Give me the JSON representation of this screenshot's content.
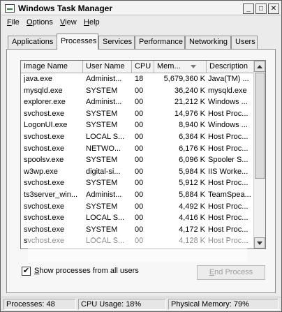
{
  "window": {
    "title": "Windows Task Manager"
  },
  "title_buttons": {
    "minimize": "_",
    "maximize": "□",
    "close": "✕"
  },
  "menu": [
    {
      "label": "File",
      "hotkey": "F",
      "rest": "ile"
    },
    {
      "label": "Options",
      "hotkey": "O",
      "rest": "ptions"
    },
    {
      "label": "View",
      "hotkey": "V",
      "rest": "iew"
    },
    {
      "label": "Help",
      "hotkey": "H",
      "rest": "elp"
    }
  ],
  "tabs": [
    {
      "label": "Applications",
      "active": false
    },
    {
      "label": "Processes",
      "active": true
    },
    {
      "label": "Services",
      "active": false
    },
    {
      "label": "Performance",
      "active": false
    },
    {
      "label": "Networking",
      "active": false
    },
    {
      "label": "Users",
      "active": false
    }
  ],
  "columns": [
    "Image Name",
    "User Name",
    "CPU",
    "Mem...",
    "Description"
  ],
  "processes": [
    {
      "name": "java.exe",
      "user": "Administ...",
      "cpu": "18",
      "mem": "5,679,360 K",
      "desc": "Java(TM) ..."
    },
    {
      "name": "mysqld.exe",
      "user": "SYSTEM",
      "cpu": "00",
      "mem": "36,240 K",
      "desc": "mysqld.exe"
    },
    {
      "name": "explorer.exe",
      "user": "Administ...",
      "cpu": "00",
      "mem": "21,212 K",
      "desc": "Windows ..."
    },
    {
      "name": "svchost.exe",
      "user": "SYSTEM",
      "cpu": "00",
      "mem": "14,976 K",
      "desc": "Host Proc..."
    },
    {
      "name": "LogonUI.exe",
      "user": "SYSTEM",
      "cpu": "00",
      "mem": "8,940 K",
      "desc": "Windows ..."
    },
    {
      "name": "svchost.exe",
      "user": "LOCAL S...",
      "cpu": "00",
      "mem": "6,364 K",
      "desc": "Host Proc..."
    },
    {
      "name": "svchost.exe",
      "user": "NETWO...",
      "cpu": "00",
      "mem": "6,176 K",
      "desc": "Host Proc..."
    },
    {
      "name": "spoolsv.exe",
      "user": "SYSTEM",
      "cpu": "00",
      "mem": "6,096 K",
      "desc": "Spooler S..."
    },
    {
      "name": "w3wp.exe",
      "user": "digital-si...",
      "cpu": "00",
      "mem": "5,984 K",
      "desc": "IIS Worke..."
    },
    {
      "name": "svchost.exe",
      "user": "SYSTEM",
      "cpu": "00",
      "mem": "5,912 K",
      "desc": "Host Proc..."
    },
    {
      "name": "ts3server_win...",
      "user": "Administ...",
      "cpu": "00",
      "mem": "5,884 K",
      "desc": "TeamSpea..."
    },
    {
      "name": "svchost.exe",
      "user": "SYSTEM",
      "cpu": "00",
      "mem": "4,492 K",
      "desc": "Host Proc..."
    },
    {
      "name": "svchost.exe",
      "user": "LOCAL S...",
      "cpu": "00",
      "mem": "4,416 K",
      "desc": "Host Proc..."
    },
    {
      "name": "svchost.exe",
      "user": "SYSTEM",
      "cpu": "00",
      "mem": "4,172 K",
      "desc": "Host Proc..."
    },
    {
      "name": "svchost.exe",
      "user": "LOCAL S...",
      "cpu": "00",
      "mem": "4,128 K",
      "desc": "Host Proc..."
    }
  ],
  "show_all_users": {
    "checked": true,
    "mark": "✔",
    "hotkey": "S",
    "rest": "how processes from all users"
  },
  "end_process_button": {
    "hotkey": "E",
    "rest": "nd Process"
  },
  "statusbar": {
    "processes": "Processes: 48",
    "cpu": "CPU Usage: 18%",
    "memory": "Physical Memory: 79%"
  }
}
